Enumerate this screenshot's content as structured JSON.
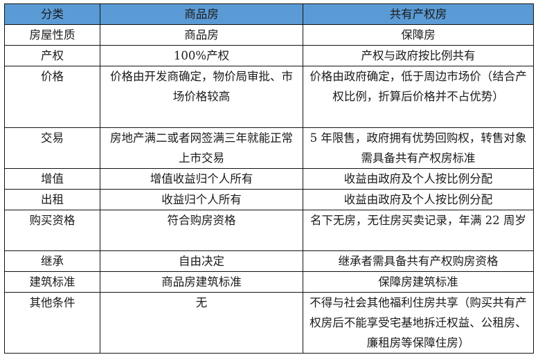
{
  "header_color": "#5b9bd5",
  "table": {
    "headers": [
      "分类",
      "商品房",
      "共有产权房"
    ],
    "rows": [
      {
        "category": "房屋性质",
        "commercial": "商品房",
        "shared": "保障房"
      },
      {
        "category": "产权",
        "commercial": "100%产权",
        "shared": "产权与政府按比例共有"
      },
      {
        "category": "价格",
        "commercial": "价格由开发商确定，物价局审批、市场价格较高",
        "shared": "价格由政府确定，低于周边市场价（结合产权比例，折算后价格并不占优势）"
      },
      {
        "category": "交易",
        "commercial": "房地产满二或者网签满三年就能正常上市交易",
        "shared": "5 年限售，政府拥有优势回购权，转售对象需具备共有产权房标准"
      },
      {
        "category": "增值",
        "commercial": "增值收益归个人所有",
        "shared": "收益由政府及个人按比例分配"
      },
      {
        "category": "出租",
        "commercial": "收益归个人所有",
        "shared": "收益由政府及个人按比例分配"
      },
      {
        "category": "购买资格",
        "commercial": "符合购房资格",
        "shared": "名下无房，无住房买卖记录，年满 22 周岁"
      },
      {
        "category": "继承",
        "commercial": "自由决定",
        "shared": "继承者需具备共有产权购房资格"
      },
      {
        "category": "建筑标准",
        "commercial": "商品房建筑标准",
        "shared": "保障房建筑标准"
      },
      {
        "category": "其他条件",
        "commercial": "无",
        "shared": "不得与社会其他福利住房共享（购买共有产权房后不能享受宅基地拆迁权益、公租房、廉租房等保障住房）"
      }
    ]
  }
}
